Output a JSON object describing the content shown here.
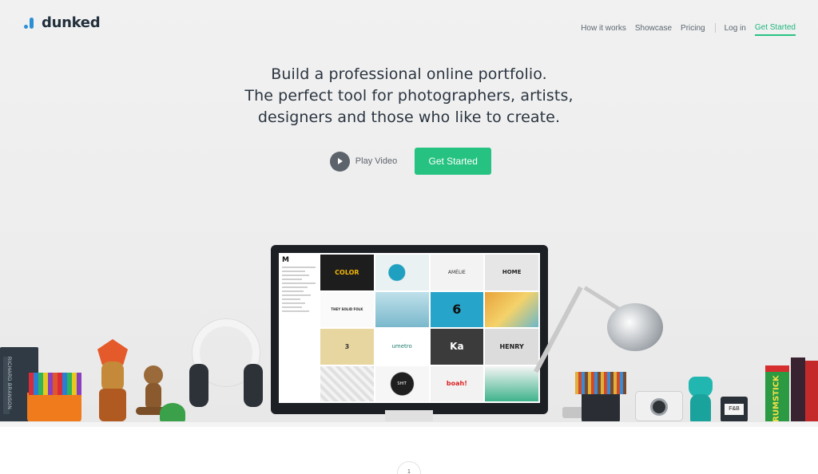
{
  "brand": {
    "name": "dunked",
    "accent": "#2c8fd6"
  },
  "nav": {
    "how_it_works": "How it works",
    "showcase": "Showcase",
    "pricing": "Pricing",
    "login": "Log in",
    "get_started": "Get Started"
  },
  "hero": {
    "line1": "Build a professional online portfolio.",
    "line2": "The perfect tool for photographers, artists,",
    "line3": "designers and those who like to create.",
    "play_video": "Play Video",
    "get_started": "Get Started",
    "cta_color": "#26c281"
  },
  "screen": {
    "logo_letter": "M",
    "tiles": [
      "COLOR",
      "",
      "AMÉLIE",
      "HOME",
      "THEY SOLID FOLK",
      "",
      "6",
      "",
      "3",
      "umetro",
      "Ka",
      "HENRY",
      "",
      "SHIT",
      "boah!",
      ""
    ]
  },
  "props": {
    "book_spine": "RICHARD BRANSON",
    "box_label": "RUMSTICK",
    "tin_label": "F&B"
  },
  "scroll_indicator": "1",
  "icons": [
    "play-icon",
    "logo-icon"
  ]
}
